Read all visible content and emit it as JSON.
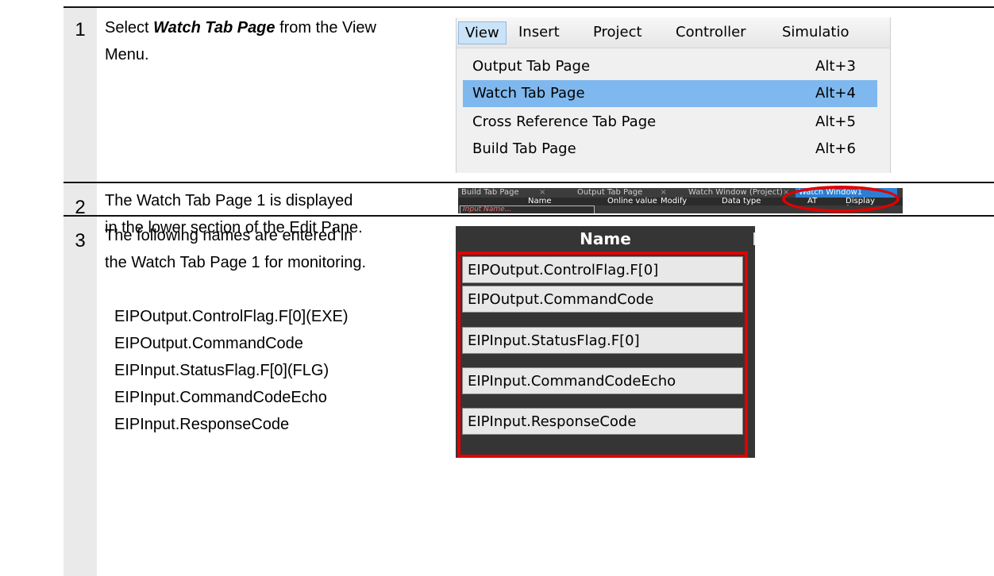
{
  "steps": [
    {
      "number": "1",
      "text_before": "Select ",
      "text_bold": "Watch Tab Page",
      "text_after": " from the View Menu."
    },
    {
      "number": "2",
      "text": "The Watch Tab Page 1 is displayed in the lower section of the Edit Pane."
    },
    {
      "number": "3",
      "text": "The following names are entered in the Watch Tab Page 1 for monitoring.",
      "names": [
        "EIPOutput.ControlFlag.F[0](EXE)",
        "EIPOutput.CommandCode",
        "EIPInput.StatusFlag.F[0](FLG)",
        "EIPInput.CommandCodeEcho",
        "EIPInput.ResponseCode"
      ]
    }
  ],
  "menu": {
    "bar": [
      "View",
      "Insert",
      "Project",
      "Controller",
      "Simulatio"
    ],
    "items": [
      {
        "label": "Output Tab Page",
        "shortcut": "Alt+3",
        "highlighted": false
      },
      {
        "label": "Watch Tab Page",
        "shortcut": "Alt+4",
        "highlighted": true
      },
      {
        "label": "Cross Reference Tab Page",
        "shortcut": "Alt+5",
        "highlighted": false
      },
      {
        "label": "Build Tab Page",
        "shortcut": "Alt+6",
        "highlighted": false
      }
    ],
    "highlight_color": "#7fb8ee"
  },
  "watch_strip": {
    "tabs": [
      "Build Tab Page",
      "Output Tab Page",
      "Watch Window (Project)",
      "Watch Window1"
    ],
    "tab_close": "×",
    "columns": [
      "Name",
      "Online value",
      "Modify",
      "Data type",
      "AT",
      "Display format"
    ],
    "input_placeholder": "Input Name..."
  },
  "name_list": {
    "header": "Name",
    "items": [
      "EIPOutput.ControlFlag.F[0]",
      "EIPOutput.CommandCode",
      "EIPInput.StatusFlag.F[0]",
      "EIPInput.CommandCodeEcho",
      "EIPInput.ResponseCode"
    ]
  },
  "colors": {
    "highlight_red": "#e00000",
    "step_column": "#eaeaea",
    "active_tab": "#2a7fd4"
  }
}
